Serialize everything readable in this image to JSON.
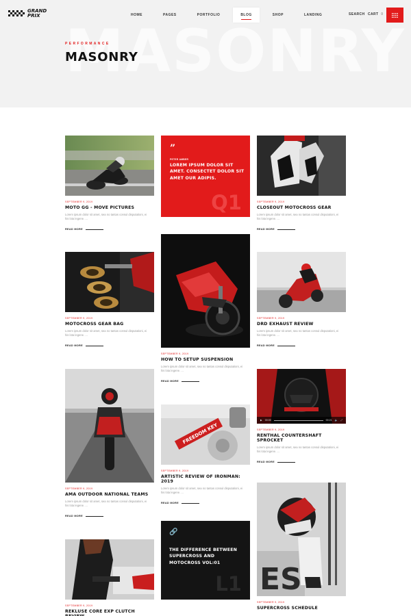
{
  "brand": {
    "name_line1": "GRAND",
    "name_line2": "PRIX"
  },
  "nav": {
    "items": [
      "HOME",
      "PAGES",
      "PORTFOLIO",
      "BLOG",
      "SHOP",
      "LANDING"
    ],
    "active": "BLOG"
  },
  "header": {
    "search": "SEARCH",
    "cart": "CART",
    "cart_count": "0",
    "menu_icon": "grid-menu-icon"
  },
  "hero": {
    "kicker": "PERFORMANCE",
    "title": "MASONRY",
    "background_word": "MASONRY"
  },
  "colors": {
    "accent": "#e21b1b",
    "hero_bg": "#f2f2f2",
    "dark_card": "#141414"
  },
  "posts": {
    "p1": {
      "date": "SEPTEMBER 9, 2019",
      "title": "MOTO GG - MOVE PICTURES",
      "excerpt": "Lorem ipsum dolor sit amet, sea no tantas consul disputationi, ei his lota legene. ...",
      "read": "READ MORE"
    },
    "p2": {
      "date": "SEPTEMBER 9, 2019",
      "title": "CLOSEOUT MOTOCROSS GEAR",
      "excerpt": "Lorem ipsum dolor sit amet, sea no tantas consul disputationi, ei his lota legene. ...",
      "read": "READ MORE"
    },
    "p3": {
      "date": "SEPTEMBER 9, 2019",
      "title": "MOTOCROSS GEAR BAG",
      "excerpt": "Lorem ipsum dolor sit amet, sea no tantas consul disputationi, ei his lota legene. ...",
      "read": "READ MORE"
    },
    "p4": {
      "date": "SEPTEMBER 9, 2019",
      "title": "HOW TO SETUP SUSPENSION",
      "excerpt": "Lorem ipsum dolor sit amet, sea no tantas consul disputationi, ei his lota legene. ...",
      "read": "READ MORE"
    },
    "p5": {
      "date": "SEPTEMBER 9, 2019",
      "title": "DRD EXHAUST REVIEW",
      "excerpt": "Lorem ipsum dolor sit amet, sea no tantas consul disputationi, ei his lota legene. ...",
      "read": "READ MORE"
    },
    "p6": {
      "date": "SEPTEMBER 9, 2019",
      "title": "AMA OUTDOOR NATIONAL TEAMS",
      "excerpt": "Lorem ipsum dolor sit amet, sea no tantas consul disputationi, ei his lota legene. ...",
      "read": "READ MORE"
    },
    "p7": {
      "date": "SEPTEMBER 9, 2019",
      "title": "ARTISTIC REVIEW OF IRONMAN: 2019",
      "excerpt": "Lorem ipsum dolor sit amet, sea no tantas consul disputationi, ei his lota legene. ...",
      "read": "READ MORE"
    },
    "p8": {
      "date": "SEPTEMBER 9, 2019",
      "title": "RENTHAL COUNTERSHAFT SPROCKET",
      "excerpt": "Lorem ipsum dolor sit amet, sea no tantas consul disputationi, ei his lota legene. ...",
      "read": "READ MORE"
    },
    "p9": {
      "date": "SEPTEMBER 9, 2019",
      "title": "REKLUSE CORE EXP CLUTCH REVIEW"
    },
    "p10": {
      "date": "SEPTEMBER 9, 2019",
      "title": "SUPERCROSS SCHEDULE"
    }
  },
  "quote": {
    "author": "PETER AMBER",
    "text": "LOREM IPSUM DOLOR SIT AMET. CONSECTET DOLOR SIT AMET OUR ADIPIS.",
    "tag": "Q1"
  },
  "link": {
    "text": "THE DIFFERENCE BETWEEN SUPERCROSS AND MOTOCROSS VOL:01",
    "tag": "L1"
  },
  "video": {
    "time_current": "00:00",
    "time_total": "00:21"
  },
  "images": {
    "fork_tag": "FREEDOM KEY",
    "stand_text": "ES"
  }
}
